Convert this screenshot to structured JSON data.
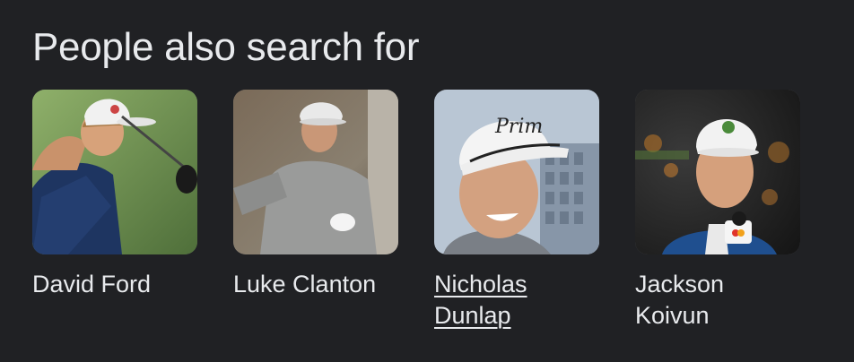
{
  "section": {
    "title": "People also search for"
  },
  "people": [
    {
      "name": "David Ford",
      "active": false
    },
    {
      "name": "Luke Clanton",
      "active": false
    },
    {
      "name": "Nicholas Dunlap",
      "active": true
    },
    {
      "name": "Jackson Koivun",
      "active": false
    }
  ]
}
